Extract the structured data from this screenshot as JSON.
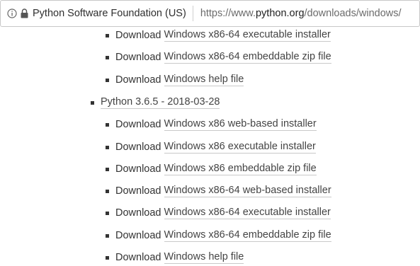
{
  "address_bar": {
    "org_name": "Python Software Foundation (US)",
    "url_prefix": "https://www.",
    "url_domain": "python.org",
    "url_path": "/downloads/windows/"
  },
  "download_word": "Download",
  "top_items": [
    {
      "link": "Windows x86-64 executable installer"
    },
    {
      "link": "Windows x86-64 embeddable zip file"
    },
    {
      "link": "Windows help file"
    }
  ],
  "release": {
    "label": "Python 3.6.5 - 2018-03-28",
    "items": [
      {
        "link": "Windows x86 web-based installer"
      },
      {
        "link": "Windows x86 executable installer"
      },
      {
        "link": "Windows x86 embeddable zip file"
      },
      {
        "link": "Windows x86-64 web-based installer"
      },
      {
        "link": "Windows x86-64 executable installer"
      },
      {
        "link": "Windows x86-64 embeddable zip file"
      },
      {
        "link": "Windows help file"
      }
    ]
  }
}
